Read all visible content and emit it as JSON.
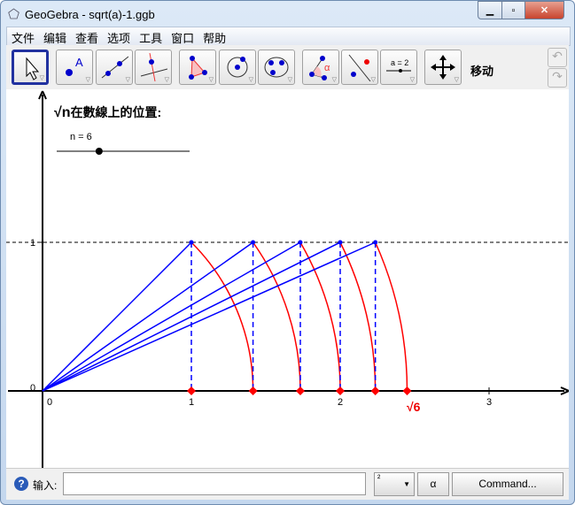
{
  "window": {
    "title": "GeoGebra - sqrt(a)-1.ggb"
  },
  "menu": [
    "文件",
    "编辑",
    "查看",
    "选项",
    "工具",
    "窗口",
    "帮助"
  ],
  "toolbar": {
    "active_tool_label": "移动"
  },
  "graph": {
    "heading_symbol": "√n",
    "heading_text": "在數線上的位置:",
    "slider_label": "n = 6",
    "slider": {
      "value": 6,
      "min": 1,
      "max": 30
    },
    "x_ticks": [
      "0",
      "1",
      "2",
      "3"
    ],
    "y_ticks": [
      "0",
      "1"
    ],
    "sqrt_label": "√6",
    "n": 6,
    "colors": {
      "lines": "#0000ff",
      "arcs": "#ff0000",
      "axis": "#000000"
    }
  },
  "input_bar": {
    "label": "输入:",
    "value": "",
    "dropdown": "²",
    "button1": "α",
    "button2": "Command..."
  }
}
